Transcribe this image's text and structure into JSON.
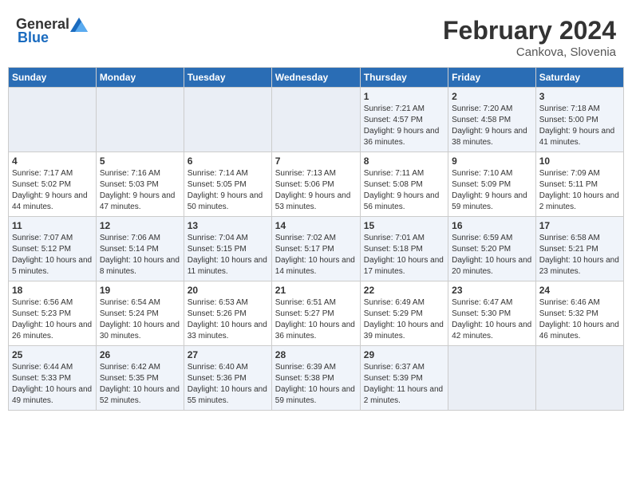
{
  "header": {
    "logo_general": "General",
    "logo_blue": "Blue",
    "title": "February 2024",
    "subtitle": "Cankova, Slovenia"
  },
  "days_of_week": [
    "Sunday",
    "Monday",
    "Tuesday",
    "Wednesday",
    "Thursday",
    "Friday",
    "Saturday"
  ],
  "weeks": [
    [
      {
        "day": "",
        "info": ""
      },
      {
        "day": "",
        "info": ""
      },
      {
        "day": "",
        "info": ""
      },
      {
        "day": "",
        "info": ""
      },
      {
        "day": "1",
        "info": "Sunrise: 7:21 AM\nSunset: 4:57 PM\nDaylight: 9 hours and 36 minutes."
      },
      {
        "day": "2",
        "info": "Sunrise: 7:20 AM\nSunset: 4:58 PM\nDaylight: 9 hours and 38 minutes."
      },
      {
        "day": "3",
        "info": "Sunrise: 7:18 AM\nSunset: 5:00 PM\nDaylight: 9 hours and 41 minutes."
      }
    ],
    [
      {
        "day": "4",
        "info": "Sunrise: 7:17 AM\nSunset: 5:02 PM\nDaylight: 9 hours and 44 minutes."
      },
      {
        "day": "5",
        "info": "Sunrise: 7:16 AM\nSunset: 5:03 PM\nDaylight: 9 hours and 47 minutes."
      },
      {
        "day": "6",
        "info": "Sunrise: 7:14 AM\nSunset: 5:05 PM\nDaylight: 9 hours and 50 minutes."
      },
      {
        "day": "7",
        "info": "Sunrise: 7:13 AM\nSunset: 5:06 PM\nDaylight: 9 hours and 53 minutes."
      },
      {
        "day": "8",
        "info": "Sunrise: 7:11 AM\nSunset: 5:08 PM\nDaylight: 9 hours and 56 minutes."
      },
      {
        "day": "9",
        "info": "Sunrise: 7:10 AM\nSunset: 5:09 PM\nDaylight: 9 hours and 59 minutes."
      },
      {
        "day": "10",
        "info": "Sunrise: 7:09 AM\nSunset: 5:11 PM\nDaylight: 10 hours and 2 minutes."
      }
    ],
    [
      {
        "day": "11",
        "info": "Sunrise: 7:07 AM\nSunset: 5:12 PM\nDaylight: 10 hours and 5 minutes."
      },
      {
        "day": "12",
        "info": "Sunrise: 7:06 AM\nSunset: 5:14 PM\nDaylight: 10 hours and 8 minutes."
      },
      {
        "day": "13",
        "info": "Sunrise: 7:04 AM\nSunset: 5:15 PM\nDaylight: 10 hours and 11 minutes."
      },
      {
        "day": "14",
        "info": "Sunrise: 7:02 AM\nSunset: 5:17 PM\nDaylight: 10 hours and 14 minutes."
      },
      {
        "day": "15",
        "info": "Sunrise: 7:01 AM\nSunset: 5:18 PM\nDaylight: 10 hours and 17 minutes."
      },
      {
        "day": "16",
        "info": "Sunrise: 6:59 AM\nSunset: 5:20 PM\nDaylight: 10 hours and 20 minutes."
      },
      {
        "day": "17",
        "info": "Sunrise: 6:58 AM\nSunset: 5:21 PM\nDaylight: 10 hours and 23 minutes."
      }
    ],
    [
      {
        "day": "18",
        "info": "Sunrise: 6:56 AM\nSunset: 5:23 PM\nDaylight: 10 hours and 26 minutes."
      },
      {
        "day": "19",
        "info": "Sunrise: 6:54 AM\nSunset: 5:24 PM\nDaylight: 10 hours and 30 minutes."
      },
      {
        "day": "20",
        "info": "Sunrise: 6:53 AM\nSunset: 5:26 PM\nDaylight: 10 hours and 33 minutes."
      },
      {
        "day": "21",
        "info": "Sunrise: 6:51 AM\nSunset: 5:27 PM\nDaylight: 10 hours and 36 minutes."
      },
      {
        "day": "22",
        "info": "Sunrise: 6:49 AM\nSunset: 5:29 PM\nDaylight: 10 hours and 39 minutes."
      },
      {
        "day": "23",
        "info": "Sunrise: 6:47 AM\nSunset: 5:30 PM\nDaylight: 10 hours and 42 minutes."
      },
      {
        "day": "24",
        "info": "Sunrise: 6:46 AM\nSunset: 5:32 PM\nDaylight: 10 hours and 46 minutes."
      }
    ],
    [
      {
        "day": "25",
        "info": "Sunrise: 6:44 AM\nSunset: 5:33 PM\nDaylight: 10 hours and 49 minutes."
      },
      {
        "day": "26",
        "info": "Sunrise: 6:42 AM\nSunset: 5:35 PM\nDaylight: 10 hours and 52 minutes."
      },
      {
        "day": "27",
        "info": "Sunrise: 6:40 AM\nSunset: 5:36 PM\nDaylight: 10 hours and 55 minutes."
      },
      {
        "day": "28",
        "info": "Sunrise: 6:39 AM\nSunset: 5:38 PM\nDaylight: 10 hours and 59 minutes."
      },
      {
        "day": "29",
        "info": "Sunrise: 6:37 AM\nSunset: 5:39 PM\nDaylight: 11 hours and 2 minutes."
      },
      {
        "day": "",
        "info": ""
      },
      {
        "day": "",
        "info": ""
      }
    ]
  ]
}
